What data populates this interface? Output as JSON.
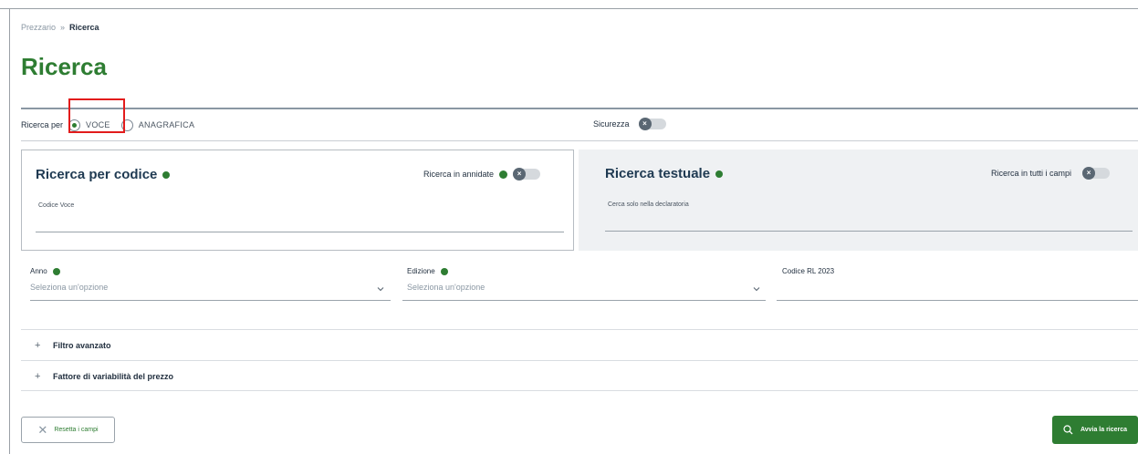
{
  "breadcrumb": {
    "parent": "Prezzario",
    "separator": "»",
    "current": "Ricerca"
  },
  "page_title": "Ricerca",
  "search_mode": {
    "label": "Ricerca per",
    "options": [
      {
        "label": "VOCE",
        "checked": true
      },
      {
        "label": "ANAGRAFICA",
        "checked": false
      }
    ]
  },
  "sicurezza": {
    "label": "Sicurezza",
    "enabled": false
  },
  "code_search": {
    "title": "Ricerca per codice",
    "switch_label": "Ricerca in annidate",
    "switch_enabled": false,
    "field_label": "Codice Voce",
    "field_value": ""
  },
  "text_search": {
    "title": "Ricerca testuale",
    "switch_label": "Ricerca in tutti i campi",
    "switch_enabled": false,
    "field_label": "Cerca solo nella declaratoria",
    "field_value": ""
  },
  "filters": {
    "anno": {
      "label": "Anno",
      "placeholder": "Seleziona un'opzione"
    },
    "edizione": {
      "label": "Edizione",
      "placeholder": "Seleziona un'opzione"
    },
    "codice_rl": {
      "label": "Codice RL 2023",
      "value": ""
    }
  },
  "accordions": [
    {
      "icon": "plus-icon",
      "label": "Filtro avanzato"
    },
    {
      "icon": "plus-icon",
      "label": "Fattore di variabilità del prezzo"
    }
  ],
  "actions": {
    "reset_label": "Resetta i campi",
    "search_label": "Avvia la ricerca"
  },
  "colors": {
    "brand_green": "#2e7d32",
    "highlight_red": "#e21c1c",
    "title_navy": "#1f3a52"
  }
}
